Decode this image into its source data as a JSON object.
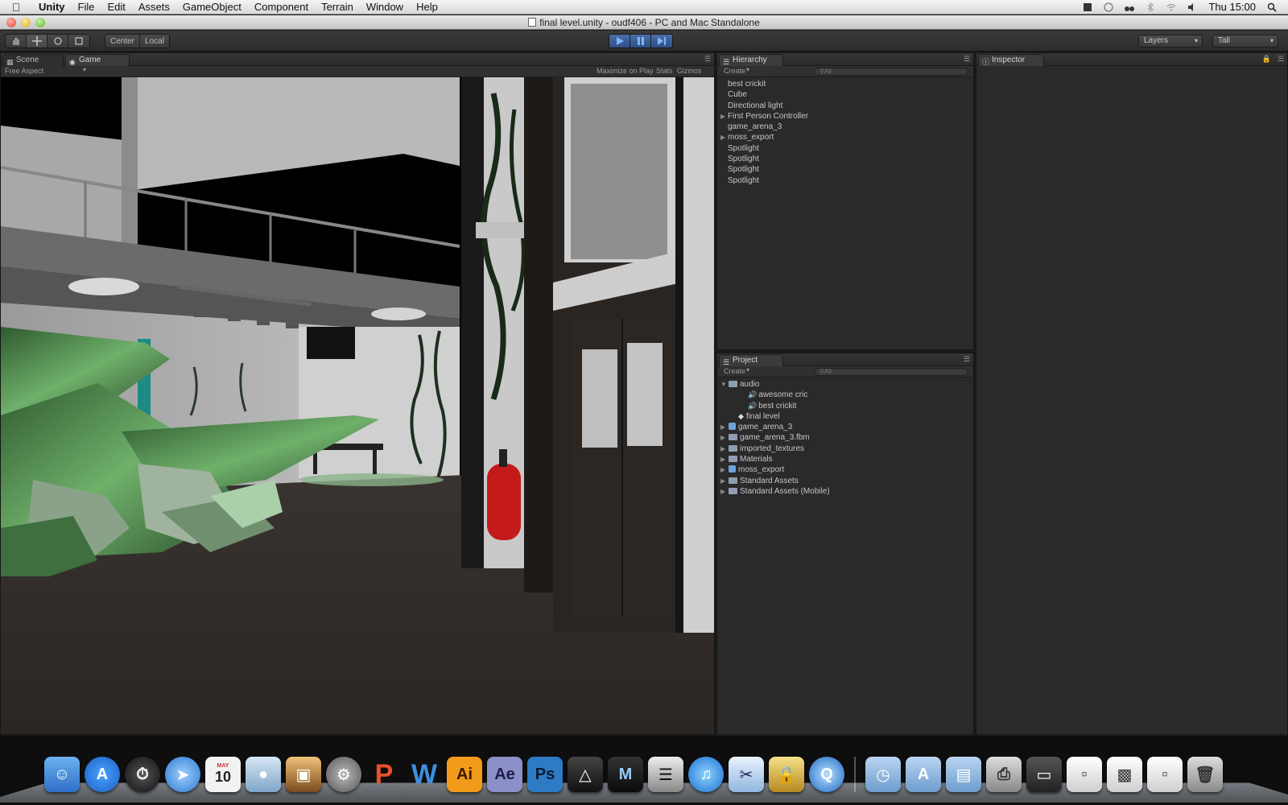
{
  "menubar": {
    "app": "Unity",
    "items": [
      "File",
      "Edit",
      "Assets",
      "GameObject",
      "Component",
      "Terrain",
      "Window",
      "Help"
    ],
    "clock": "Thu 15:00"
  },
  "window": {
    "title": "final level.unity - oudf406 - PC and Mac Standalone"
  },
  "toolbar": {
    "pivot_label": "Center",
    "space_label": "Local",
    "layers_label": "Layers",
    "layout_label": "Tall"
  },
  "game_panel": {
    "tabs": [
      "Scene",
      "Game"
    ],
    "aspect": "Free Aspect",
    "maximize_label": "Maximize on Play",
    "stats_label": "Stats",
    "gizmos_label": "Gizmos"
  },
  "hierarchy": {
    "title": "Hierarchy",
    "create_label": "Create",
    "search_placeholder": "All",
    "items": [
      {
        "label": "best crickit",
        "expandable": false
      },
      {
        "label": "Cube",
        "expandable": false
      },
      {
        "label": "Directional light",
        "expandable": false
      },
      {
        "label": "First Person Controller",
        "expandable": true
      },
      {
        "label": "game_arena_3",
        "expandable": false
      },
      {
        "label": "moss_export",
        "expandable": true
      },
      {
        "label": "Spotlight",
        "expandable": false
      },
      {
        "label": "Spotlight",
        "expandable": false
      },
      {
        "label": "Spotlight",
        "expandable": false
      },
      {
        "label": "Spotlight",
        "expandable": false
      }
    ]
  },
  "project": {
    "title": "Project",
    "create_label": "Create",
    "search_placeholder": "All",
    "items": [
      {
        "label": "audio",
        "type": "folder",
        "indent": 0,
        "expanded": true
      },
      {
        "label": "awesome cric",
        "type": "audio",
        "indent": 2
      },
      {
        "label": "best crickit",
        "type": "audio",
        "indent": 2
      },
      {
        "label": "final level",
        "type": "scene",
        "indent": 1
      },
      {
        "label": "game_arena_3",
        "type": "prefab",
        "indent": 0
      },
      {
        "label": "game_arena_3.fbm",
        "type": "folder",
        "indent": 0
      },
      {
        "label": "imported_textures",
        "type": "folder",
        "indent": 0
      },
      {
        "label": "Materials",
        "type": "folder",
        "indent": 0
      },
      {
        "label": "moss_export",
        "type": "prefab",
        "indent": 0
      },
      {
        "label": "Standard Assets",
        "type": "folder",
        "indent": 0
      },
      {
        "label": "Standard Assets (Mobile)",
        "type": "folder",
        "indent": 0
      }
    ]
  },
  "inspector": {
    "title": "Inspector"
  },
  "dock": {
    "calendar_day": "10",
    "calendar_month": "MAY",
    "apps": [
      "Finder",
      "App Store",
      "Dashboard",
      "Safari",
      "iCal",
      "iPhoto",
      "Preview",
      "System Preferences",
      "PowerPoint",
      "Word",
      "Illustrator",
      "After Effects",
      "Photoshop",
      "Unity",
      "Maya",
      "Final Cut",
      "iTunes",
      "Grab",
      "Keychain",
      "QuickTime"
    ]
  }
}
